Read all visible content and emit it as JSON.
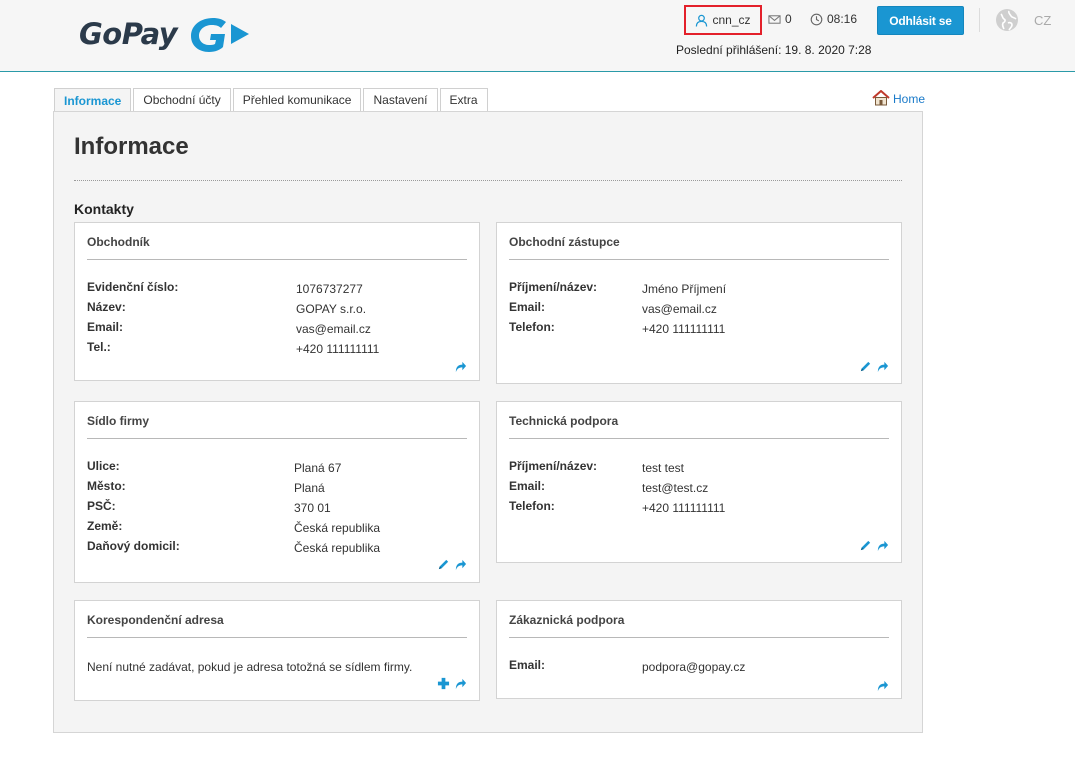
{
  "header": {
    "logo_text": "GoPay",
    "username": "cnn_cz",
    "message_count": "0",
    "time": "08:16",
    "logout_label": "Odhlásit se",
    "language": "CZ",
    "last_login": "Poslední přihlášení: 19. 8. 2020 7:28"
  },
  "tabs": [
    {
      "label": "Informace",
      "active": true
    },
    {
      "label": "Obchodní účty",
      "active": false
    },
    {
      "label": "Přehled komunikace",
      "active": false
    },
    {
      "label": "Nastavení",
      "active": false
    },
    {
      "label": "Extra",
      "active": false
    }
  ],
  "home_label": "Home",
  "page_title": "Informace",
  "section_title": "Kontakty",
  "cards": {
    "merchant": {
      "title": "Obchodník",
      "rows": [
        {
          "label": "Evidenční číslo:",
          "value": "1076737277"
        },
        {
          "label": "Název:",
          "value": "GOPAY s.r.o."
        },
        {
          "label": "Email:",
          "value": "vas@email.cz"
        },
        {
          "label": "Tel.:",
          "value": "+420 111111111"
        }
      ]
    },
    "representative": {
      "title": "Obchodní zástupce",
      "rows": [
        {
          "label": "Příjmení/název:",
          "value": "Jméno Příjmení"
        },
        {
          "label": "Email:",
          "value": "vas@email.cz"
        },
        {
          "label": "Telefon:",
          "value": "+420 111111111"
        }
      ]
    },
    "seat": {
      "title": "Sídlo firmy",
      "rows": [
        {
          "label": "Ulice:",
          "value": "Planá 67"
        },
        {
          "label": "Město:",
          "value": "Planá"
        },
        {
          "label": "PSČ:",
          "value": "370 01"
        },
        {
          "label": "Země:",
          "value": "Česká republika"
        },
        {
          "label": "Daňový domicil:",
          "value": "Česká republika"
        }
      ]
    },
    "tech_support": {
      "title": "Technická podpora",
      "rows": [
        {
          "label": "Příjmení/název:",
          "value": "test test"
        },
        {
          "label": "Email:",
          "value": "test@test.cz"
        },
        {
          "label": "Telefon:",
          "value": "+420 111111111"
        }
      ]
    },
    "correspondence": {
      "title": "Korespondenční adresa",
      "note": "Není nutné zadávat, pokud je adresa totožná se sídlem firmy."
    },
    "customer_support": {
      "title": "Zákaznická podpora",
      "rows": [
        {
          "label": "Email:",
          "value": "podpora@gopay.cz"
        }
      ]
    }
  },
  "colors": {
    "accent": "#1a96d2",
    "header_border": "#2a9aa8",
    "highlight_box": "#e3202a",
    "logo_dark": "#2b3a4a",
    "logo_blue": "#1a96d2"
  },
  "icons": [
    "user-icon",
    "envelope-icon",
    "clock-icon",
    "globe-icon",
    "home-icon",
    "edit-pencil-icon",
    "share-arrow-icon",
    "add-plus-icon"
  ]
}
